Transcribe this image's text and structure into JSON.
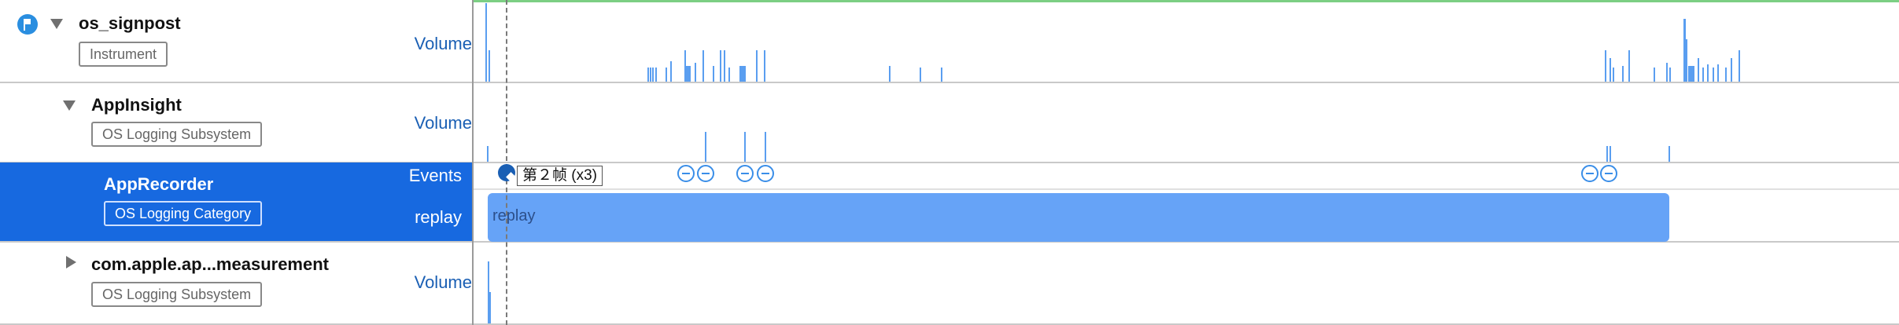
{
  "rows": [
    {
      "key": "os_signpost",
      "title": "os_signpost",
      "tag": "Instrument",
      "track": "Volume",
      "expanded": true
    },
    {
      "key": "appinsight",
      "title": "AppInsight",
      "tag": "OS Logging Subsystem",
      "track": "Volume",
      "expanded": true
    },
    {
      "key": "apprecorder",
      "title": "AppRecorder",
      "tag": "OS Logging Category",
      "track_events": "Events",
      "track_replay": "replay",
      "selected": true
    },
    {
      "key": "measurement",
      "title": "com.apple.ap...measurement",
      "tag": "OS Logging Subsystem",
      "track": "Volume",
      "expanded": false
    }
  ],
  "timeline": {
    "tooltip": "第２帧 (x3)",
    "replay_label": "replay"
  },
  "colors": {
    "selection": "#1769e0",
    "accent": "#3a8ee8",
    "replay_bar": "#66a3f7",
    "top_bar": "#7ccf84"
  },
  "icons": {
    "instrument": "signpost-flag-icon",
    "expanded": "disclosure-down-icon",
    "collapsed": "disclosure-right-icon"
  }
}
